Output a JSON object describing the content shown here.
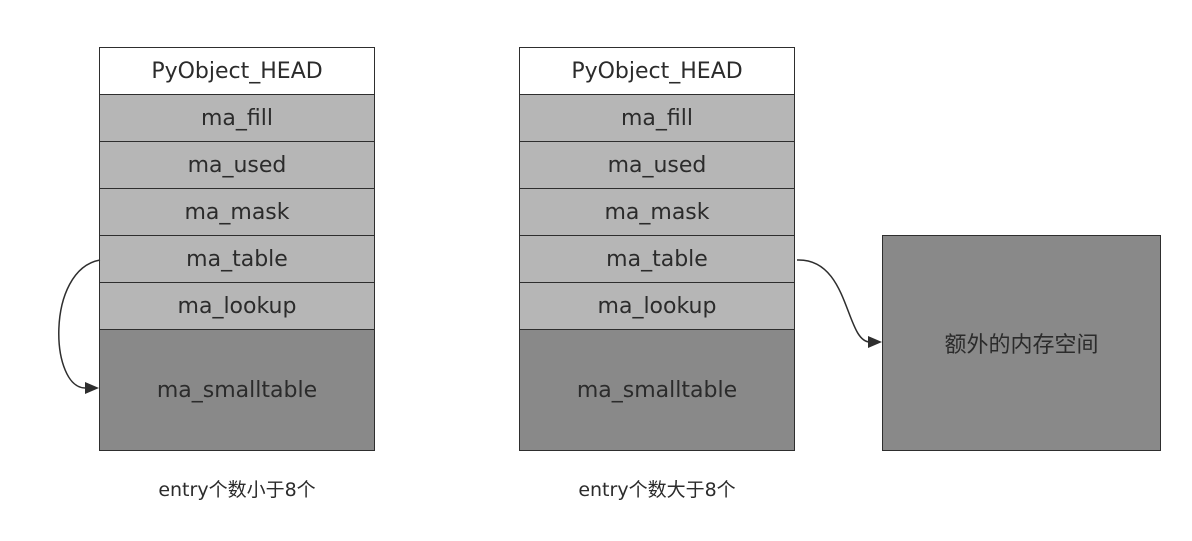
{
  "left_struct": {
    "fields": [
      "PyObject_HEAD",
      "ma_fill",
      "ma_used",
      "ma_mask",
      "ma_table",
      "ma_lookup"
    ],
    "smalltable": "ma_smalltable",
    "caption": "entry个数小于8个"
  },
  "right_struct": {
    "fields": [
      "PyObject_HEAD",
      "ma_fill",
      "ma_used",
      "ma_mask",
      "ma_table",
      "ma_lookup"
    ],
    "smalltable": "ma_smalltable",
    "caption": "entry个数大于8个"
  },
  "extra_memory": {
    "label": "额外的内存空间"
  },
  "colors": {
    "header_bg": "#ffffff",
    "field_bg": "#b6b6b6",
    "smalltable_bg": "#898989",
    "border": "#2e2e2e"
  }
}
